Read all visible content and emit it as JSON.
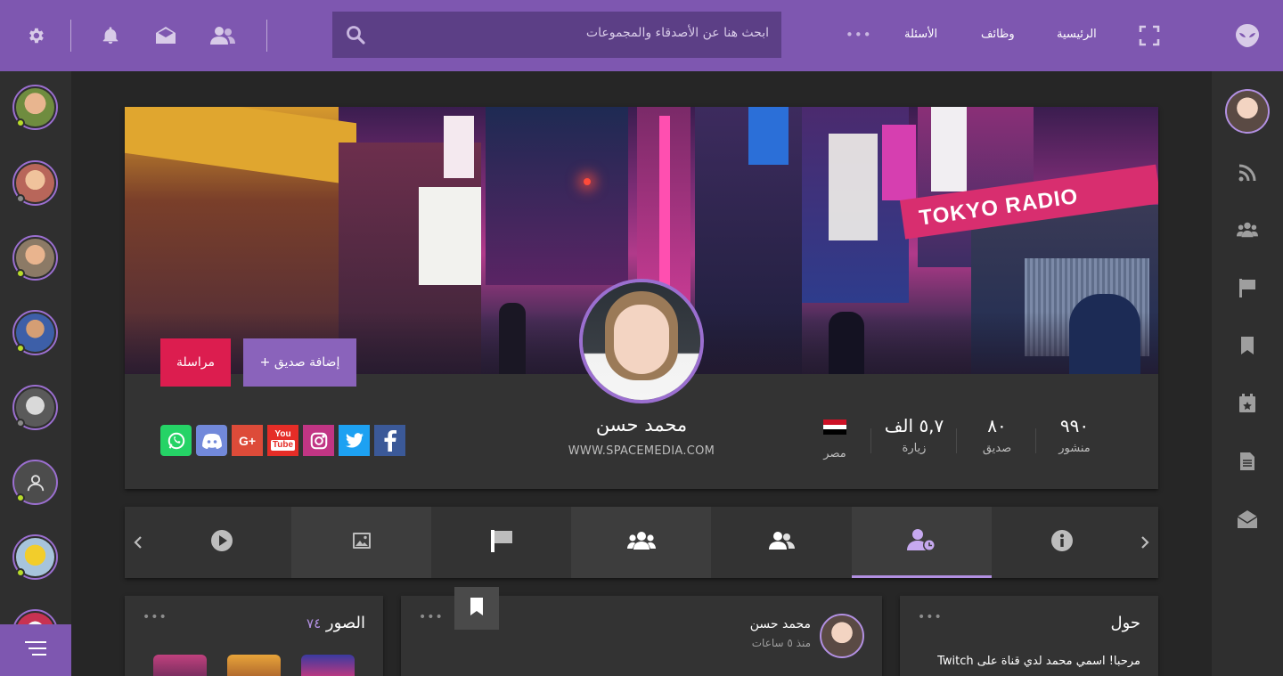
{
  "topbar": {
    "nav": {
      "home": "الرئيسية",
      "jobs": "وظائف",
      "questions": "الأسئلة"
    },
    "more_dots": "•••",
    "search_placeholder": "ابحث هنا عن الأصدقاء والمجموعات",
    "icons": [
      "alien-logo-icon",
      "fullscreen-icon",
      "search-icon",
      "friends-icon",
      "envelope-icon",
      "bell-icon",
      "gear-icon"
    ]
  },
  "left_sidebar": {
    "friends": [
      {
        "status": "online"
      },
      {
        "status": "offline"
      },
      {
        "status": "online"
      },
      {
        "status": "online"
      },
      {
        "status": "offline"
      },
      {
        "status": "online"
      },
      {
        "status": "online"
      },
      {
        "status": "unknown"
      }
    ],
    "icons": [
      "menu-icon"
    ]
  },
  "right_sidebar": {
    "icons": [
      "user-avatar",
      "rss-icon",
      "groups-icon",
      "flag-icon",
      "bookmark-icon",
      "calendar-star-icon",
      "document-icon",
      "open-envelope-icon"
    ]
  },
  "profile": {
    "name": "محمد حسن",
    "website": "WWW.SPACEMEDIA.COM",
    "buttons": {
      "message": "مراسلة",
      "add_friend": "إضافة صديق +"
    },
    "stats": [
      {
        "value": "٩٩٠",
        "label": "منشور"
      },
      {
        "value": "٨٠",
        "label": "صديق"
      },
      {
        "value": "٥,٧ الف",
        "label": "زيارة"
      }
    ],
    "country": "مصر",
    "social": [
      "facebook",
      "twitter",
      "instagram",
      "youtube",
      "google-plus",
      "discord",
      "whatsapp"
    ]
  },
  "tabs": {
    "items": [
      "info-icon",
      "timeline-icon",
      "friends-icon",
      "groups-icon",
      "flag-icon",
      "photos-icon",
      "video-icon"
    ],
    "active": "timeline-icon"
  },
  "panels": {
    "photos": {
      "title": "الصور",
      "count": "٧٤",
      "dots": "•••"
    },
    "post": {
      "author": "محمد حسن",
      "time": "منذ ٥ ساعات",
      "dots": "•••"
    },
    "about": {
      "title": "حول",
      "text": "مرحبا! اسمي محمد لدي قناة على Twitch",
      "dots": "•••"
    }
  },
  "colors": {
    "accent": "#7e57b0",
    "accent_dark": "#5c3f86",
    "danger": "#dc1d4f",
    "online": "#b8dc2a"
  }
}
